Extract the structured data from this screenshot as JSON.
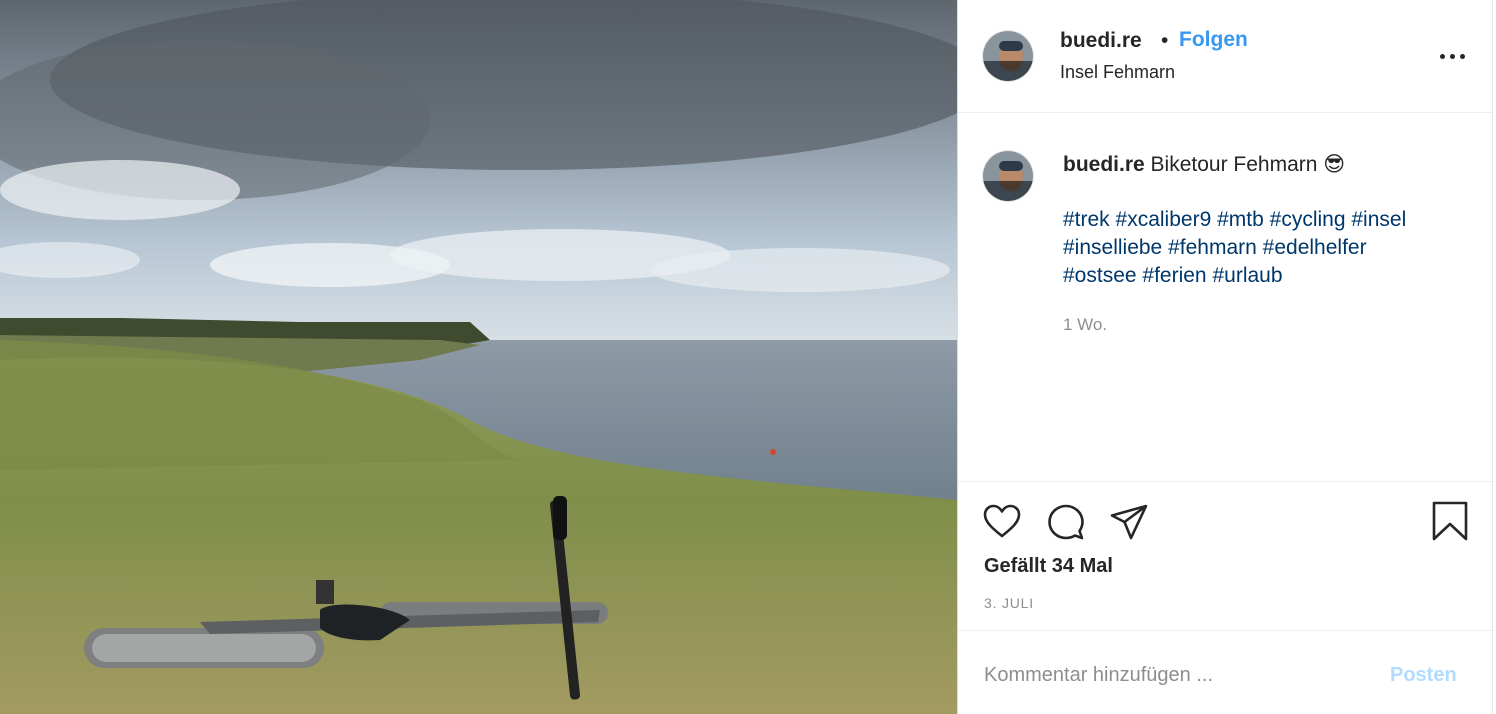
{
  "post": {
    "image_alt": "Fahrrad liegt im Gras an der Steilküste, Blick auf die Ostsee unter bewölktem Himmel"
  },
  "header": {
    "username": "buedi.re",
    "separator": "•",
    "follow_label": "Folgen",
    "location": "Insel Fehmarn"
  },
  "caption": {
    "username": "buedi.re",
    "text": "Biketour Fehmarn",
    "emoji": "😎",
    "hashtags": [
      "#trek",
      "#xcaliber9",
      "#mtb",
      "#cycling",
      "#insel",
      "#inselliebe",
      "#fehmarn",
      "#edelhelfer",
      "#ostsee",
      "#ferien",
      "#urlaub"
    ],
    "time_ago": "1 Wo."
  },
  "actions": {
    "icons": [
      "heart-icon",
      "comment-icon",
      "share-icon",
      "bookmark-icon"
    ],
    "likes_text": "Gefällt 34 Mal",
    "date": "3. JULI"
  },
  "comment": {
    "placeholder": "Kommentar hinzufügen ...",
    "post_label": "Posten"
  },
  "colors": {
    "link_blue": "#3897f0",
    "hashtag_blue": "#00376b",
    "muted_gray": "#8e8e8e",
    "post_disabled": "#b3dbff"
  }
}
